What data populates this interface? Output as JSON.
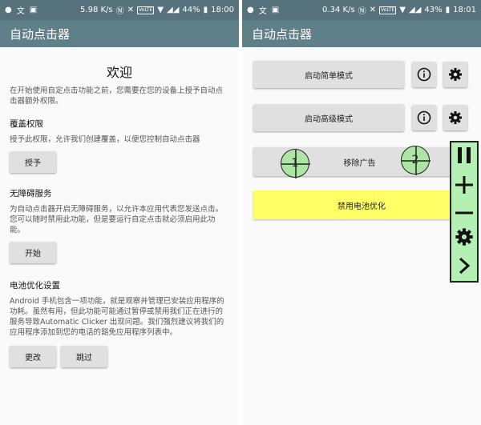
{
  "left": {
    "status": {
      "speed": "5.98 K/s",
      "battery": "44%",
      "time": "18:00",
      "volte": "VoLTE"
    },
    "app_title": "自动点击器",
    "welcome": "欢迎",
    "intro": "在开始使用自定点击功能之前，您需要在您的设备上授予自动点击器额外权限。",
    "overlay": {
      "title": "覆盖权限",
      "desc": "授予此权限，允许我们创建覆盖，以便您控制自动点击器",
      "button": "授予"
    },
    "accessibility": {
      "title": "无障碍服务",
      "desc": "为自动点击器开启无障碍服务，以允许本应用代表您发送点击。您可以随时禁用此功能，但是要运行自定点击就必须启用此功能。",
      "button": "开始"
    },
    "battery": {
      "title": "电池优化设置",
      "desc": "Android 手机包含一项功能，就是观察并管理已安装应用程序的功耗。虽然有用，但此功能可能通过暂停或禁用我们正在进行的服务导致Automatic Clicker 出现问题。我们强烈建议将我们的应用程序添加到您的电话的豁免应用程序列表中。",
      "change_button": "更改",
      "skip_button": "跳过"
    }
  },
  "right": {
    "status": {
      "speed": "0.34 K/s",
      "battery": "43%",
      "time": "18:01",
      "volte": "VoLTE"
    },
    "app_title": "自动点击器",
    "simple_mode": "启动简单模式",
    "advanced_mode": "启动高级模式",
    "remove_ads": "移除广告",
    "disable_battery": "禁用电池优化",
    "target1": "1",
    "target2": "2"
  }
}
